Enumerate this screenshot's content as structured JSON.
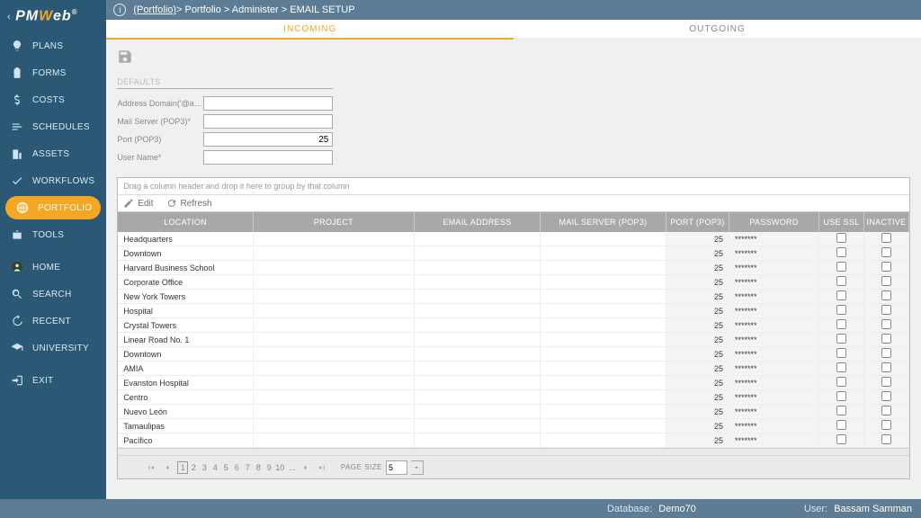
{
  "topbar": {
    "info": "i",
    "breadcrumb_link": "(Portfolio)",
    "breadcrumb_rest": " > Portfolio > Administer > EMAIL SETUP"
  },
  "tabs": {
    "incoming": "INCOMING",
    "outgoing": "OUTGOING"
  },
  "sidebar": {
    "items": [
      {
        "label": "PLANS",
        "icon": "bulb"
      },
      {
        "label": "FORMS",
        "icon": "clipboard"
      },
      {
        "label": "COSTS",
        "icon": "dollar"
      },
      {
        "label": "SCHEDULES",
        "icon": "bars"
      },
      {
        "label": "ASSETS",
        "icon": "building"
      },
      {
        "label": "WORKFLOWS",
        "icon": "check"
      },
      {
        "label": "PORTFOLIO",
        "icon": "globe",
        "active": true
      },
      {
        "label": "TOOLS",
        "icon": "briefcase"
      }
    ],
    "items2": [
      {
        "label": "HOME",
        "icon": "avatar"
      },
      {
        "label": "SEARCH",
        "icon": "search"
      },
      {
        "label": "RECENT",
        "icon": "history"
      },
      {
        "label": "UNIVERSITY",
        "icon": "grad"
      }
    ],
    "items3": [
      {
        "label": "EXIT",
        "icon": "exit"
      }
    ]
  },
  "defaults": {
    "title": "DEFAULTS",
    "address_label": "Address Domain('@acm...",
    "mailserver_label": "Mail Server (POP3)*",
    "port_label": "Port (POP3)",
    "username_label": "User Name*",
    "port_value": "25"
  },
  "grid": {
    "group_hint": "Drag a column header and drop it here to group by that column",
    "toolbar": {
      "edit": "Edit",
      "refresh": "Refresh"
    },
    "columns": [
      "LOCATION",
      "PROJECT",
      "EMAIL ADDRESS",
      "MAIL SERVER (POP3)",
      "PORT (POP3)",
      "PASSWORD",
      "USE SSL",
      "INACTIVE"
    ],
    "rows": [
      {
        "location": "Headquarters",
        "port": "25",
        "pw": "*******"
      },
      {
        "location": "Downtown",
        "port": "25",
        "pw": "*******"
      },
      {
        "location": "Harvard Business School",
        "port": "25",
        "pw": "*******"
      },
      {
        "location": "Corporate Office",
        "port": "25",
        "pw": "*******"
      },
      {
        "location": "New York Towers",
        "port": "25",
        "pw": "*******"
      },
      {
        "location": "Hospital",
        "port": "25",
        "pw": "*******"
      },
      {
        "location": "Crystal Towers",
        "port": "25",
        "pw": "*******"
      },
      {
        "location": "Linear Road No. 1",
        "port": "25",
        "pw": "*******"
      },
      {
        "location": "Downtown",
        "port": "25",
        "pw": "*******"
      },
      {
        "location": "AMIA",
        "port": "25",
        "pw": "*******"
      },
      {
        "location": "Evanston Hospital",
        "port": "25",
        "pw": "*******"
      },
      {
        "location": "Centro",
        "port": "25",
        "pw": "*******"
      },
      {
        "location": "Nuevo León",
        "port": "25",
        "pw": "*******"
      },
      {
        "location": "Tamaulipas",
        "port": "25",
        "pw": "*******"
      },
      {
        "location": "Pacífico",
        "port": "25",
        "pw": "*******"
      }
    ],
    "pager": {
      "size_label": "PAGE SIZE",
      "size_value": "5",
      "pages": [
        "1",
        "2",
        "3",
        "4",
        "5",
        "6",
        "7",
        "8",
        "9",
        "10"
      ],
      "ellipsis": "..."
    }
  },
  "footer": {
    "db_label": "Database:",
    "db_value": "Demo70",
    "user_label": "User:",
    "user_value": "Bassam Samman"
  }
}
